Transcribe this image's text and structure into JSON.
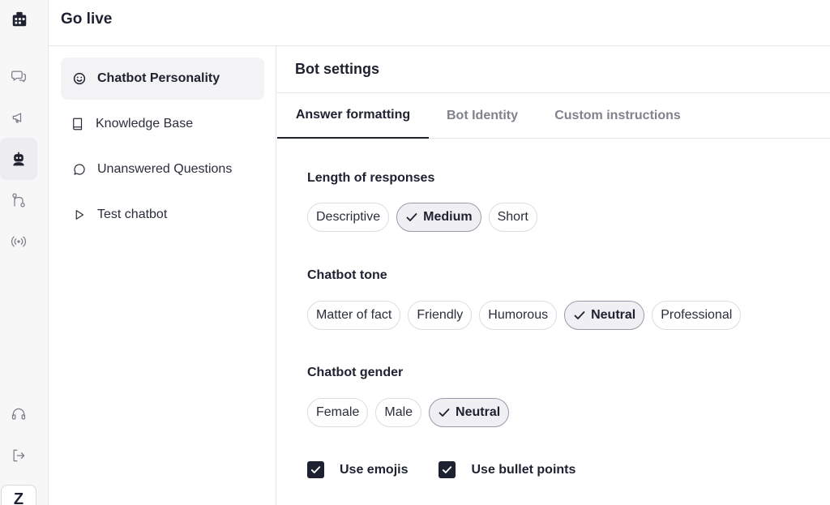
{
  "header": {
    "title": "Go live"
  },
  "rail": {
    "logo_icon": "grid-building-icon",
    "items": [
      {
        "icon": "chat-bubbles-icon",
        "active": false
      },
      {
        "icon": "megaphone-icon",
        "active": false
      },
      {
        "icon": "robot-icon",
        "active": true
      },
      {
        "icon": "git-branch-icon",
        "active": false
      },
      {
        "icon": "broadcast-icon",
        "active": false
      }
    ],
    "bottom": [
      {
        "icon": "headset-icon"
      },
      {
        "icon": "logout-icon"
      }
    ],
    "avatar_letter": "Z"
  },
  "subnav": {
    "items": [
      {
        "label": "Chatbot Personality",
        "icon": "smiley-icon",
        "active": true
      },
      {
        "label": "Knowledge Base",
        "icon": "book-icon",
        "active": false
      },
      {
        "label": "Unanswered Questions",
        "icon": "speech-bubble-icon",
        "active": false
      },
      {
        "label": "Test chatbot",
        "icon": "play-icon",
        "active": false
      }
    ]
  },
  "main": {
    "title": "Bot settings",
    "tabs": [
      {
        "label": "Answer formatting",
        "active": true
      },
      {
        "label": "Bot Identity",
        "active": false
      },
      {
        "label": "Custom instructions",
        "active": false
      }
    ],
    "sections": [
      {
        "title": "Length of responses",
        "options": [
          {
            "label": "Descriptive",
            "selected": false
          },
          {
            "label": "Medium",
            "selected": true
          },
          {
            "label": "Short",
            "selected": false
          }
        ]
      },
      {
        "title": "Chatbot tone",
        "options": [
          {
            "label": "Matter of fact",
            "selected": false
          },
          {
            "label": "Friendly",
            "selected": false
          },
          {
            "label": "Humorous",
            "selected": false
          },
          {
            "label": "Neutral",
            "selected": true
          },
          {
            "label": "Professional",
            "selected": false
          }
        ]
      },
      {
        "title": "Chatbot gender",
        "options": [
          {
            "label": "Female",
            "selected": false
          },
          {
            "label": "Male",
            "selected": false
          },
          {
            "label": "Neutral",
            "selected": true
          }
        ]
      }
    ],
    "checkboxes": [
      {
        "label": "Use emojis",
        "checked": true
      },
      {
        "label": "Use bullet points",
        "checked": true
      }
    ]
  },
  "colors": {
    "text": "#1e2230",
    "muted": "#80828c",
    "border": "#e6e6ea",
    "selected_chip_bg": "#efeff4"
  }
}
